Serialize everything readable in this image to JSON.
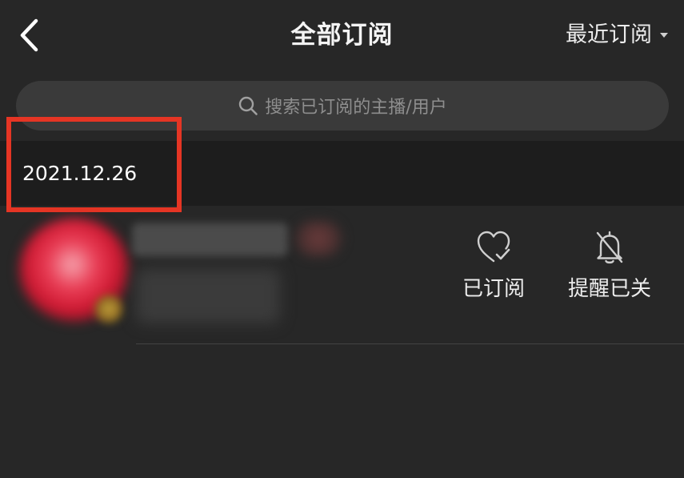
{
  "header": {
    "back_icon": "chevron-left-icon",
    "title": "全部订阅",
    "sort_label": "最近订阅",
    "sort_icon": "caret-down-icon"
  },
  "search": {
    "icon": "search-icon",
    "placeholder": "搜索已订阅的主播/用户"
  },
  "date_group": {
    "date": "2021.12.26",
    "highlight_color": "#e53524"
  },
  "subscriptions": [
    {
      "name_blurred": true,
      "avatar_color": "#cc1730",
      "actions": {
        "subscribed_label": "已订阅",
        "subscribed_icon": "heart-check-icon",
        "reminder_label": "提醒已关",
        "reminder_icon": "bell-off-icon"
      }
    }
  ],
  "colors": {
    "background": "#272727",
    "search_background": "#3a3a3a",
    "section_background": "#1d1d1d",
    "text": "#ffffff"
  }
}
